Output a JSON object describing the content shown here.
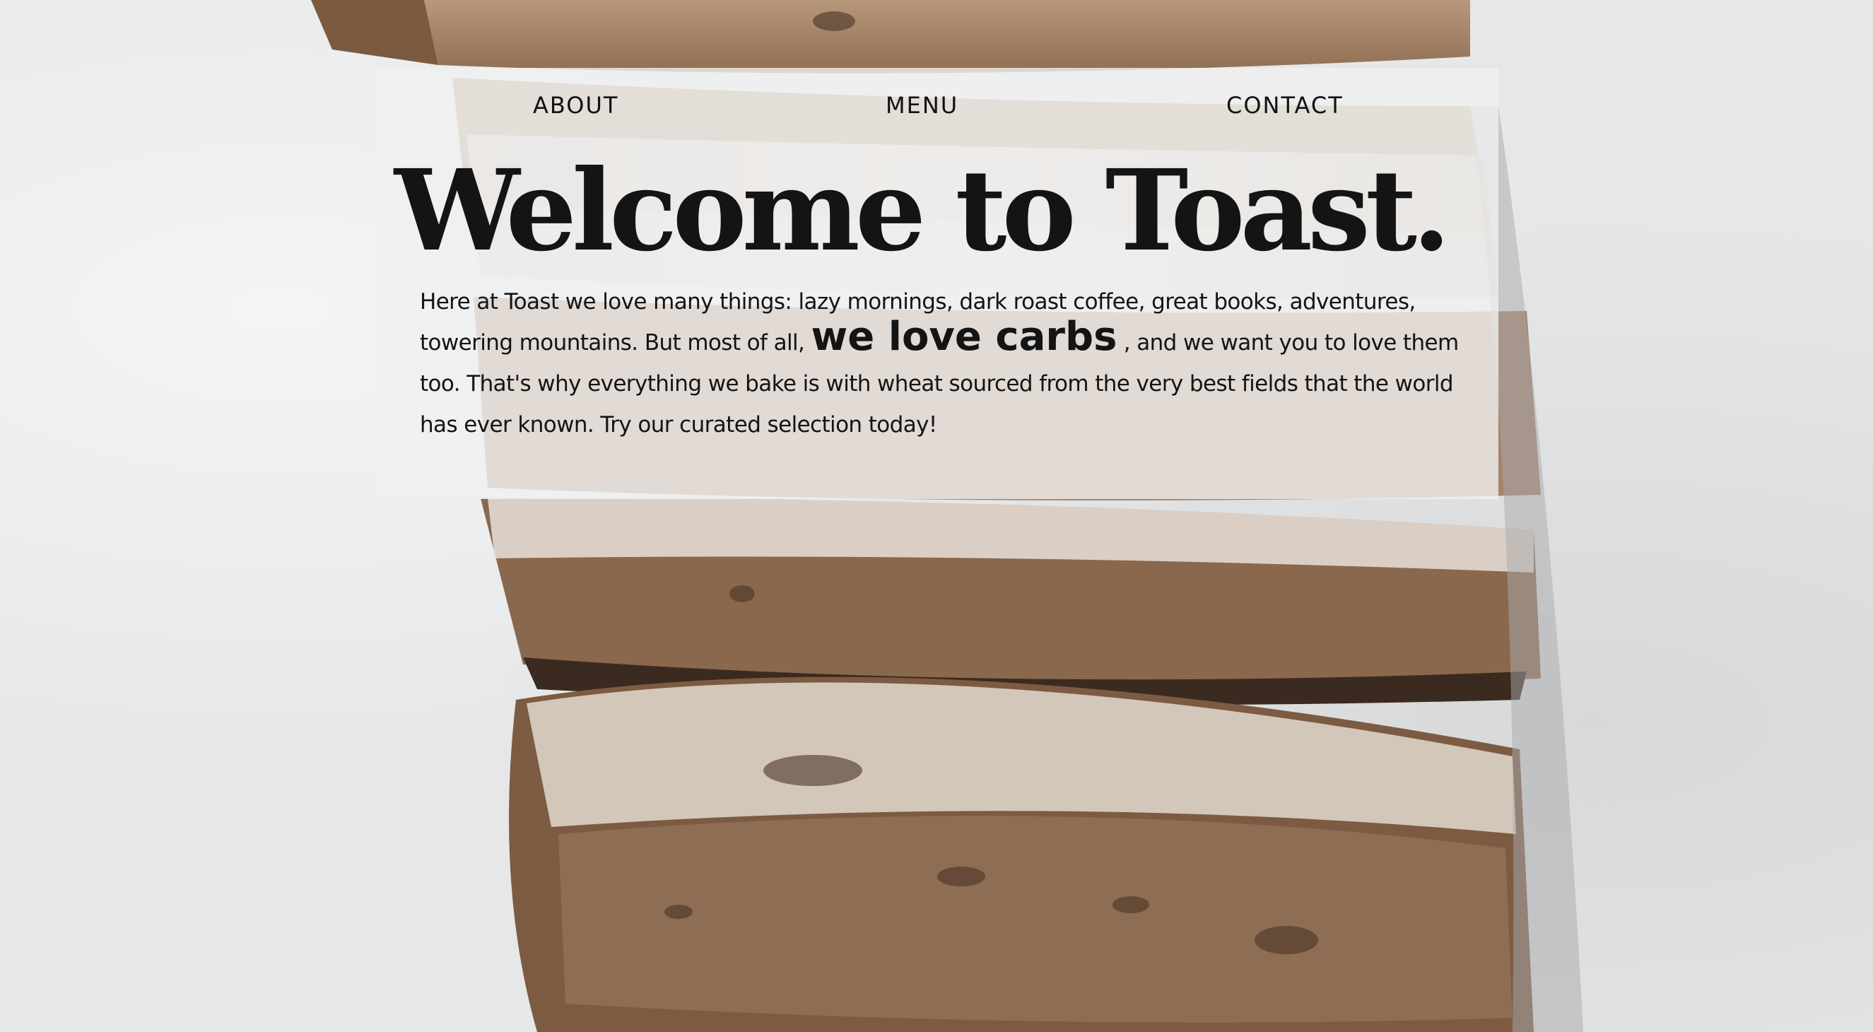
{
  "nav": {
    "items": [
      {
        "label": "ABOUT"
      },
      {
        "label": "MENU"
      },
      {
        "label": "CONTACT"
      }
    ]
  },
  "hero": {
    "title": "Welcome to Toast.",
    "intro_before": "Here at Toast we love many things: lazy mornings, dark roast coffee, great books, adventures, towering mountains. But most of all,",
    "emphasis": "we love carbs",
    "intro_after": ", and we want you to love them too. That's why everything we bake is with wheat sourced from the very best fields that the world has ever known. Try our curated selection today!"
  },
  "colors": {
    "background": "#e6e7e8",
    "panel": "#f0f0f0",
    "text": "#141414",
    "crust": "#6a4a34",
    "crumb": "#a88a70"
  }
}
